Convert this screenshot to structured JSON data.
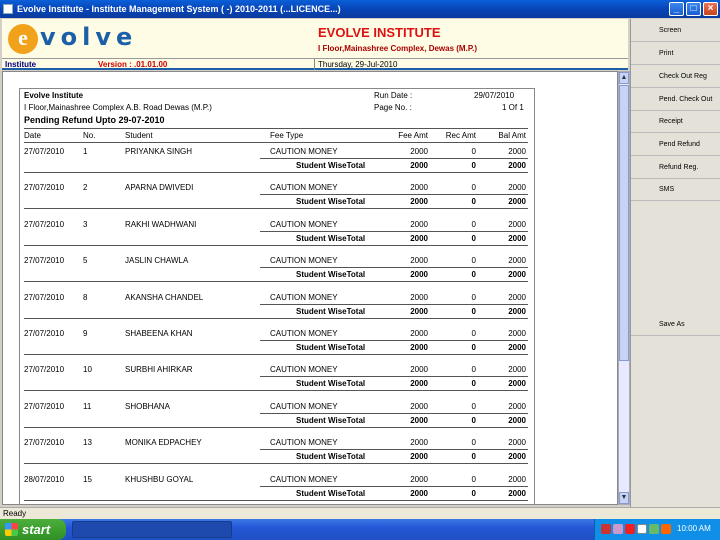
{
  "window": {
    "title": "Evolve Institute - Institute Management System ( -) 2010-2011 (...LICENCE...)",
    "buttons": {
      "minimize": "_",
      "maximize": "□",
      "close": "×"
    }
  },
  "header": {
    "logo_letter": "e",
    "logo_text": "volve",
    "institute_name": "EVOLVE INSTITUTE",
    "institute_address": "I Floor,Mainashree Complex, Dewas (M.P.)",
    "left_label": "Institute",
    "version": "Version : .01.01.00",
    "date": "Thursday, 29-Jul-2010"
  },
  "report": {
    "org": "Evolve Institute",
    "address": "I Floor,Mainashree Complex A.B. Road Dewas (M.P.)",
    "title": "Pending Refund Upto 29-07-2010",
    "run_date_label": "Run Date :",
    "run_date": "29/07/2010",
    "page_label": "Page No. :",
    "page": "1 Of 1",
    "columns": [
      "Date",
      "No.",
      "Student",
      "Fee Type",
      "Fee Amt",
      "Rec Amt",
      "Bal Amt"
    ],
    "subtotal_label": "Student WiseTotal",
    "rows": [
      {
        "date": "27/07/2010",
        "no": "1",
        "student": "PRIYANKA SINGH",
        "fee_type": "CAUTION MONEY",
        "fee": "2000",
        "rec": "0",
        "bal": "2000",
        "t_fee": "2000",
        "t_rec": "0",
        "t_bal": "2000"
      },
      {
        "date": "27/07/2010",
        "no": "2",
        "student": "APARNA  DWIVEDI",
        "fee_type": "CAUTION MONEY",
        "fee": "2000",
        "rec": "0",
        "bal": "2000",
        "t_fee": "2000",
        "t_rec": "0",
        "t_bal": "2000"
      },
      {
        "date": "27/07/2010",
        "no": "3",
        "student": "RAKHI WADHWANI",
        "fee_type": "CAUTION MONEY",
        "fee": "2000",
        "rec": "0",
        "bal": "2000",
        "t_fee": "2000",
        "t_rec": "0",
        "t_bal": "2000"
      },
      {
        "date": "27/07/2010",
        "no": "5",
        "student": "JASLIN  CHAWLA",
        "fee_type": "CAUTION MONEY",
        "fee": "2000",
        "rec": "0",
        "bal": "2000",
        "t_fee": "2000",
        "t_rec": "0",
        "t_bal": "2000"
      },
      {
        "date": "27/07/2010",
        "no": "8",
        "student": "AKANSHA CHANDEL",
        "fee_type": "CAUTION MONEY",
        "fee": "2000",
        "rec": "0",
        "bal": "2000",
        "t_fee": "2000",
        "t_rec": "0",
        "t_bal": "2000"
      },
      {
        "date": "27/07/2010",
        "no": "9",
        "student": "SHABEENA KHAN",
        "fee_type": "CAUTION MONEY",
        "fee": "2000",
        "rec": "0",
        "bal": "2000",
        "t_fee": "2000",
        "t_rec": "0",
        "t_bal": "2000"
      },
      {
        "date": "27/07/2010",
        "no": "10",
        "student": "SURBHI  AHIRKAR",
        "fee_type": "CAUTION MONEY",
        "fee": "2000",
        "rec": "0",
        "bal": "2000",
        "t_fee": "2000",
        "t_rec": "0",
        "t_bal": "2000"
      },
      {
        "date": "27/07/2010",
        "no": "11",
        "student": "SHOBHANA",
        "fee_type": "CAUTION MONEY",
        "fee": "2000",
        "rec": "0",
        "bal": "2000",
        "t_fee": "2000",
        "t_rec": "0",
        "t_bal": "2000"
      },
      {
        "date": "27/07/2010",
        "no": "13",
        "student": "MONIKA  EDPACHEY",
        "fee_type": "CAUTION MONEY",
        "fee": "2000",
        "rec": "0",
        "bal": "2000",
        "t_fee": "2000",
        "t_rec": "0",
        "t_bal": "2000"
      },
      {
        "date": "28/07/2010",
        "no": "15",
        "student": "KHUSHBU  GOYAL",
        "fee_type": "CAUTION MONEY",
        "fee": "2000",
        "rec": "0",
        "bal": "2000",
        "t_fee": "2000",
        "t_rec": "0",
        "t_bal": "2000"
      }
    ]
  },
  "right_panel": [
    "Screen",
    "Print",
    "Check Out Reg",
    "Pend. Check Out",
    "Receipt",
    "Pend Refund",
    "Refund Reg.",
    "SMS",
    "Save As"
  ],
  "status": "Ready",
  "taskbar": {
    "start": "start",
    "clock": "10:00 AM"
  },
  "colors": {
    "brand_blue": "#1b5fa8",
    "logo_orange": "#f2a21a",
    "title_red": "#dd1111"
  }
}
